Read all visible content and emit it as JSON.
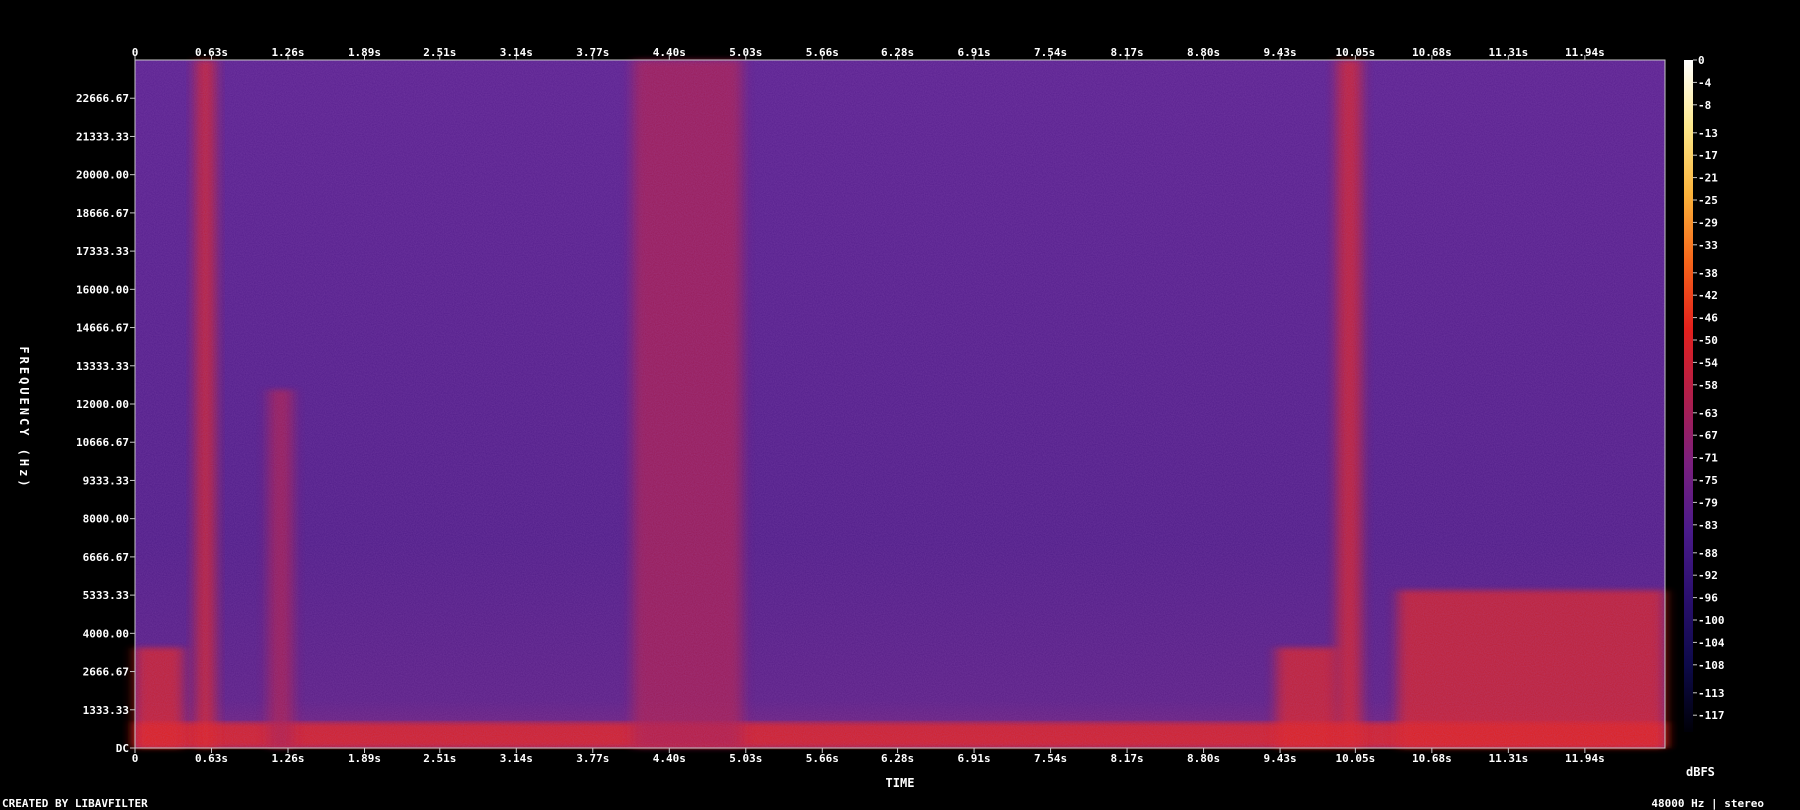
{
  "chart_data": {
    "type": "heatmap",
    "title": "",
    "xlabel": "TIME",
    "ylabel": "FREQUENCY (Hz)",
    "colorbar_unit": "dBFS",
    "x_ticks": [
      "0",
      "0.63s",
      "1.26s",
      "1.89s",
      "2.51s",
      "3.14s",
      "3.77s",
      "4.40s",
      "5.03s",
      "5.66s",
      "6.28s",
      "6.91s",
      "7.54s",
      "8.17s",
      "8.80s",
      "9.43s",
      "10.05s",
      "10.68s",
      "11.31s",
      "11.94s"
    ],
    "x_tick_values": [
      0,
      0.63,
      1.26,
      1.89,
      2.51,
      3.14,
      3.77,
      4.4,
      5.03,
      5.66,
      6.28,
      6.91,
      7.54,
      8.17,
      8.8,
      9.43,
      10.05,
      10.68,
      11.31,
      11.94
    ],
    "xlim": [
      0,
      12.6
    ],
    "y_ticks": [
      "DC",
      "1333.33",
      "2666.67",
      "4000.00",
      "5333.33",
      "6666.67",
      "8000.00",
      "9333.33",
      "10666.67",
      "12000.00",
      "13333.33",
      "14666.67",
      "16000.00",
      "17333.33",
      "18666.67",
      "20000.00",
      "21333.33",
      "22666.67"
    ],
    "y_tick_values": [
      0,
      1333.33,
      2666.67,
      4000,
      5333.33,
      6666.67,
      8000,
      9333.33,
      10666.67,
      12000,
      13333.33,
      14666.67,
      16000,
      17333.33,
      18666.67,
      20000,
      21333.33,
      22666.67
    ],
    "ylim": [
      0,
      24000
    ],
    "colorbar_ticks": [
      "0",
      "-4",
      "-8",
      "-13",
      "-17",
      "-21",
      "-25",
      "-29",
      "-33",
      "-38",
      "-42",
      "-46",
      "-50",
      "-54",
      "-58",
      "-63",
      "-67",
      "-71",
      "-75",
      "-79",
      "-83",
      "-88",
      "-92",
      "-96",
      "-100",
      "-104",
      "-108",
      "-113",
      "-117"
    ],
    "colorbar_values": [
      0,
      -4,
      -8,
      -13,
      -17,
      -21,
      -25,
      -29,
      -33,
      -38,
      -42,
      -46,
      -50,
      -54,
      -58,
      -63,
      -67,
      -71,
      -75,
      -79,
      -83,
      -88,
      -92,
      -96,
      -100,
      -104,
      -108,
      -113,
      -117
    ],
    "colorbar_range": [
      -120,
      0
    ],
    "background_level_dbfs": -85,
    "loud_regions": [
      {
        "t_start": 0.0,
        "t_end": 0.4,
        "f_max": 3500,
        "level_dbfs": -50
      },
      {
        "t_start": 0.5,
        "t_end": 0.66,
        "f_max": 24000,
        "level_dbfs": -50
      },
      {
        "t_start": 1.1,
        "t_end": 1.3,
        "f_max": 12500,
        "level_dbfs": -58
      },
      {
        "t_start": 4.1,
        "t_end": 5.0,
        "f_max": 24000,
        "level_dbfs": -63
      },
      {
        "t_start": 9.4,
        "t_end": 9.9,
        "f_max": 3500,
        "level_dbfs": -54
      },
      {
        "t_start": 9.9,
        "t_end": 10.1,
        "f_max": 24000,
        "level_dbfs": -50
      },
      {
        "t_start": 10.4,
        "t_end": 12.6,
        "f_max": 5500,
        "level_dbfs": -54
      }
    ],
    "gradient_colors": [
      "#000008",
      "#0d0a4a",
      "#2a0f6e",
      "#4a1a8a",
      "#7a1f7e",
      "#b01e4a",
      "#e3201c",
      "#f6651a",
      "#fbb23a",
      "#fde88a",
      "#ffffff"
    ]
  },
  "footer": {
    "created_by": "CREATED BY LIBAVFILTER",
    "format": "48000 Hz | stereo"
  }
}
